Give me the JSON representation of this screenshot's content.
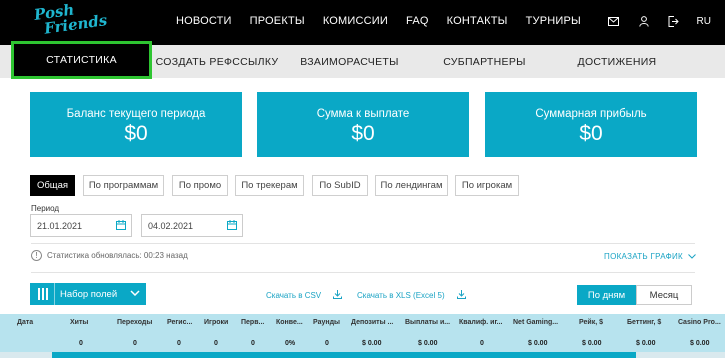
{
  "brand": {
    "line1": "Posh",
    "line2": "Friends",
    "color": "#1fb6cf"
  },
  "nav": [
    "НОВОСТИ",
    "ПРОЕКТЫ",
    "КОМИССИИ",
    "FAQ",
    "КОНТАКТЫ",
    "ТУРНИРЫ"
  ],
  "header_icons": [
    "mail-icon",
    "user-icon",
    "logout-icon"
  ],
  "language": "RU",
  "tabs": [
    "СТАТИСТИКА",
    "СОЗДАТЬ РЕФССЫЛКУ",
    "ВЗАИМОРАСЧЕТЫ",
    "СУБПАРТНЕРЫ",
    "ДОСТИЖЕНИЯ"
  ],
  "active_tab": "СТАТИСТИКА",
  "cards": [
    {
      "title": "Баланс текущего периода",
      "value": "$0"
    },
    {
      "title": "Сумма к выплате",
      "value": "$0"
    },
    {
      "title": "Суммарная прибыль",
      "value": "$0"
    }
  ],
  "filters": [
    "Общая",
    "По программам",
    "По промо",
    "По трекерам",
    "По SubID",
    "По лендингам",
    "По игрокам"
  ],
  "active_filter": "Общая",
  "period": {
    "label": "Период",
    "from": "21.01.2021",
    "to": "04.02.2021"
  },
  "status_text": "Статистика обновлялась: 00:23 назад",
  "show_graph": "ПОКАЗАТЬ ГРАФИК",
  "fields_button": "Набор полей",
  "export": {
    "csv": "Скачать в CSV",
    "xls": "Скачать в XLS (Excel 5)"
  },
  "granularity": {
    "days": "По дням",
    "month": "Месяц"
  },
  "table": {
    "headers": [
      "Дата",
      "Хиты",
      "Переходы",
      "Регис...",
      "Игроки",
      "Перв...",
      "Конве...",
      "Раунды",
      "Депозиты ...",
      "Выплаты и...",
      "Квалиф. иг...",
      "Net Gaming...",
      "Рейк, $",
      "Беттинг, $",
      "Casino Pro..."
    ],
    "row": [
      "",
      "0",
      "0",
      "0",
      "0",
      "0",
      "0%",
      "0",
      "$ 0.00",
      "$ 0.00",
      "0",
      "$ 0.00",
      "$ 0.00",
      "$ 0.00",
      "$ 0.00"
    ]
  },
  "colors": {
    "accent": "#0aa8c6",
    "highlight": "#2ec531",
    "table_bg": "#b7e3ee"
  }
}
